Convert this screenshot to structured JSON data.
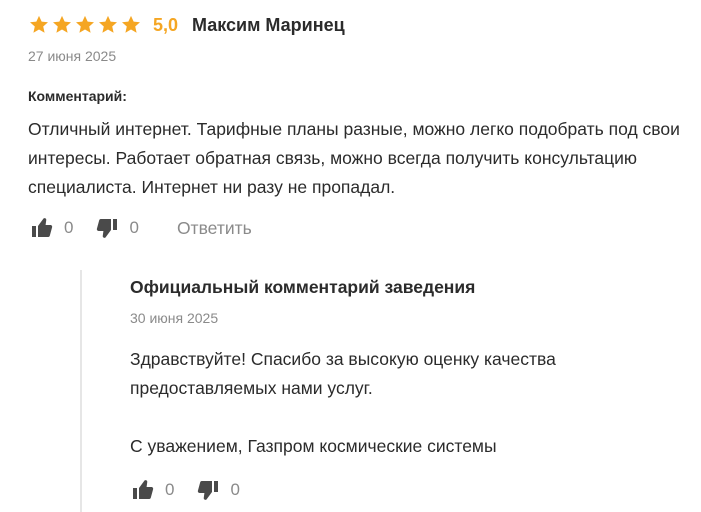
{
  "review": {
    "rating_value": 5,
    "rating_label": "5,0",
    "author": "Максим Маринец",
    "date": "27 июня 2025",
    "comment_label": "Комментарий:",
    "text": "Отличный интернет. Тарифные планы разные, можно легко подобрать под свои интересы. Работает обратная связь, можно всегда получить консультацию специалиста. Интернет ни разу не пропадал.",
    "likes": "0",
    "dislikes": "0",
    "reply_label": "Ответить"
  },
  "official_reply": {
    "title": "Официальный комментарий заведения",
    "date": "30 июня 2025",
    "text": "Здравствуйте! Спасибо за высокую оценку качества предоставляемых нами услуг.\n\nС уважением, Газпром космические системы",
    "likes": "0",
    "dislikes": "0"
  },
  "colors": {
    "star": "#f5a623",
    "rating": "#f5a623",
    "icon": "#4a4a4a",
    "muted": "#8a8a8a",
    "divider": "#e6e6e6"
  },
  "icons": {
    "star": "star-icon",
    "like": "thumbs-up-icon",
    "dislike": "thumbs-down-icon"
  }
}
